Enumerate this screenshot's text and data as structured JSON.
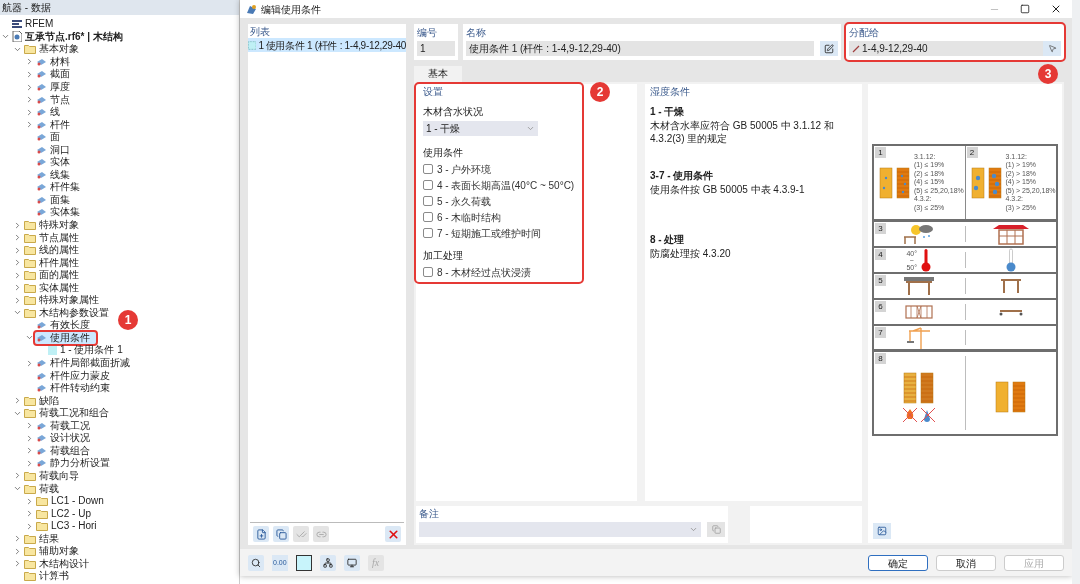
{
  "navigator": {
    "title": "航器 - 数据",
    "tree": [
      {
        "label": "RFEM",
        "kind": "app",
        "selected": false
      },
      {
        "label": "互承节点.rf6* | 木结构",
        "kind": "model",
        "selected": false,
        "expanded": true,
        "children": [
          {
            "label": "基本对象",
            "kind": "folder",
            "selected": false,
            "expanded": true,
            "children": [
              {
                "label": "材料",
                "kind": "object",
                "selected": false,
                "expanded": false
              },
              {
                "label": "截面",
                "kind": "object",
                "selected": false,
                "expanded": false
              },
              {
                "label": "厚度",
                "kind": "object",
                "selected": false,
                "expanded": false
              },
              {
                "label": "节点",
                "kind": "object",
                "selected": false,
                "expanded": false
              },
              {
                "label": "线",
                "kind": "object",
                "selected": false,
                "expanded": false
              },
              {
                "label": "杆件",
                "kind": "object",
                "selected": false,
                "expanded": false
              },
              {
                "label": "面",
                "kind": "object",
                "selected": false
              },
              {
                "label": "洞口",
                "kind": "object",
                "selected": false
              },
              {
                "label": "实体",
                "kind": "object",
                "selected": false
              },
              {
                "label": "线集",
                "kind": "object",
                "selected": false
              },
              {
                "label": "杆件集",
                "kind": "object",
                "selected": false
              },
              {
                "label": "面集",
                "kind": "object",
                "selected": false
              },
              {
                "label": "实体集",
                "kind": "object",
                "selected": false
              }
            ]
          },
          {
            "label": "特殊对象",
            "kind": "folder",
            "selected": false,
            "expanded": false
          },
          {
            "label": "节点属性",
            "kind": "folder",
            "selected": false,
            "expanded": false
          },
          {
            "label": "线的属性",
            "kind": "folder",
            "selected": false,
            "expanded": false
          },
          {
            "label": "杆件属性",
            "kind": "folder",
            "selected": false,
            "expanded": false
          },
          {
            "label": "面的属性",
            "kind": "folder",
            "selected": false,
            "expanded": false
          },
          {
            "label": "实体属性",
            "kind": "folder",
            "selected": false,
            "expanded": false
          },
          {
            "label": "特殊对象属性",
            "kind": "folder",
            "selected": false,
            "expanded": false
          },
          {
            "label": "木结构参数设置",
            "kind": "folder",
            "selected": false,
            "expanded": true,
            "children": [
              {
                "label": "有效长度",
                "kind": "object",
                "selected": false
              },
              {
                "label": "使用条件",
                "kind": "object",
                "selected": true,
                "expanded": true,
                "callout": "1",
                "children": [
                  {
                    "label": "1 - 使用条件 1",
                    "kind": "entry",
                    "selected": false
                  }
                ]
              },
              {
                "label": "杆件局部截面折减",
                "kind": "object",
                "selected": false,
                "expanded": false
              },
              {
                "label": "杆件应力蒙皮",
                "kind": "object",
                "selected": false
              },
              {
                "label": "杆件转动约束",
                "kind": "object",
                "selected": false
              }
            ]
          },
          {
            "label": "缺陷",
            "kind": "folder",
            "selected": false,
            "expanded": false
          },
          {
            "label": "荷载工况和组合",
            "kind": "folder",
            "selected": false,
            "expanded": true,
            "children": [
              {
                "label": "荷载工况",
                "kind": "object",
                "selected": false,
                "expanded": false
              },
              {
                "label": "设计状况",
                "kind": "object",
                "selected": false,
                "expanded": false
              },
              {
                "label": "荷载组合",
                "kind": "object",
                "selected": false,
                "expanded": false
              },
              {
                "label": "静力分析设置",
                "kind": "object",
                "selected": false,
                "expanded": false
              }
            ]
          },
          {
            "label": "荷载向导",
            "kind": "folder",
            "selected": false,
            "expanded": false
          },
          {
            "label": "荷载",
            "kind": "folder",
            "selected": false,
            "expanded": true,
            "children": [
              {
                "label": "LC1 - Down",
                "kind": "folder",
                "selected": false,
                "expanded": false
              },
              {
                "label": "LC2 - Up",
                "kind": "folder",
                "selected": false,
                "expanded": false
              },
              {
                "label": "LC3 - Hori",
                "kind": "folder",
                "selected": false,
                "expanded": false
              }
            ]
          },
          {
            "label": "结果",
            "kind": "folder",
            "selected": false,
            "expanded": false
          },
          {
            "label": "辅助对象",
            "kind": "folder",
            "selected": false,
            "expanded": false
          },
          {
            "label": "木结构设计",
            "kind": "folder",
            "selected": false,
            "expanded": false
          },
          {
            "label": "计算书",
            "kind": "folder",
            "selected": false
          }
        ]
      }
    ]
  },
  "dialog": {
    "title": "编辑使用条件",
    "list": {
      "heading": "列表",
      "items": [
        {
          "number": "1",
          "label": "使用条件 1 (杆件 : 1-4,9-12,29-40",
          "selected": true
        }
      ]
    },
    "number": {
      "label": "编号",
      "value": "1"
    },
    "name": {
      "label": "名称",
      "value": "使用条件 1 (杆件 : 1-4,9-12,29-40)"
    },
    "assigned_to": {
      "label": "分配给",
      "value": "1-4,9-12,29-40",
      "callout": "3"
    },
    "tabs": [
      {
        "label": "基本",
        "selected": true
      }
    ],
    "settings": {
      "heading": "设置",
      "callout": "2",
      "moisture_label": "木材含水状况",
      "moisture_value": "1 - 干燥",
      "conditions_label": "使用条件",
      "conditions": [
        {
          "label": "3 - 户外环境",
          "checked": false
        },
        {
          "label": "4 - 表面长期高温(40°C ~ 50°C)",
          "checked": false
        },
        {
          "label": "5 - 永久荷载",
          "checked": false
        },
        {
          "label": "6 - 木临时结构",
          "checked": false
        },
        {
          "label": "7 - 短期施工或维护时间",
          "checked": false
        }
      ],
      "treatment_label": "加工处理",
      "treatment": [
        {
          "label": "8 - 木材经过点状浸渍",
          "checked": false
        }
      ]
    },
    "humidity": {
      "heading": "湿度条件",
      "sections": [
        {
          "title": "1 - 干燥",
          "text": "木材含水率应符合 GB 50005 中 3.1.12 和 4.3.2(3) 里的规定"
        },
        {
          "title": "3-7 - 使用条件",
          "text": "使用条件按 GB 50005 中表 4.3.9-1"
        },
        {
          "title": "8 - 处理",
          "text": "防腐处理按 4.3.20"
        }
      ]
    },
    "reference": [
      {
        "kind": "moisture",
        "cells": [
          {
            "number": "1",
            "lines": [
              "3.1.12:",
              "(1) ≤ 19%",
              "(2) ≤ 18%",
              "(4) ≤ 15%",
              "(5) ≤ 25,20,18%",
              "4.3.2:",
              "(3) ≤ 25%"
            ]
          },
          {
            "number": "2",
            "lines": [
              "3.1.12:",
              "(1) > 19%",
              "(2) > 18%",
              "(4) > 15%",
              "(5) > 25,20,18%",
              "4.3.2:",
              "(3) > 25%"
            ]
          }
        ]
      },
      {
        "kind": "outdoor",
        "number": "3"
      },
      {
        "kind": "temperature",
        "number": "4",
        "labels": [
          "40°",
          "~",
          "50°"
        ]
      },
      {
        "kind": "load",
        "number": "5"
      },
      {
        "kind": "temporary",
        "number": "6"
      },
      {
        "kind": "construction",
        "number": "7"
      },
      {
        "kind": "treatment",
        "number": "8"
      }
    ],
    "comment": {
      "label": "备注"
    },
    "tool_labels": {
      "decimal": "0.00",
      "function": "fx"
    },
    "buttons": [
      {
        "label": "确定",
        "default": true,
        "disabled": false
      },
      {
        "label": "取消",
        "default": false,
        "disabled": false
      },
      {
        "label": "应用",
        "default": false,
        "disabled": true
      }
    ]
  }
}
